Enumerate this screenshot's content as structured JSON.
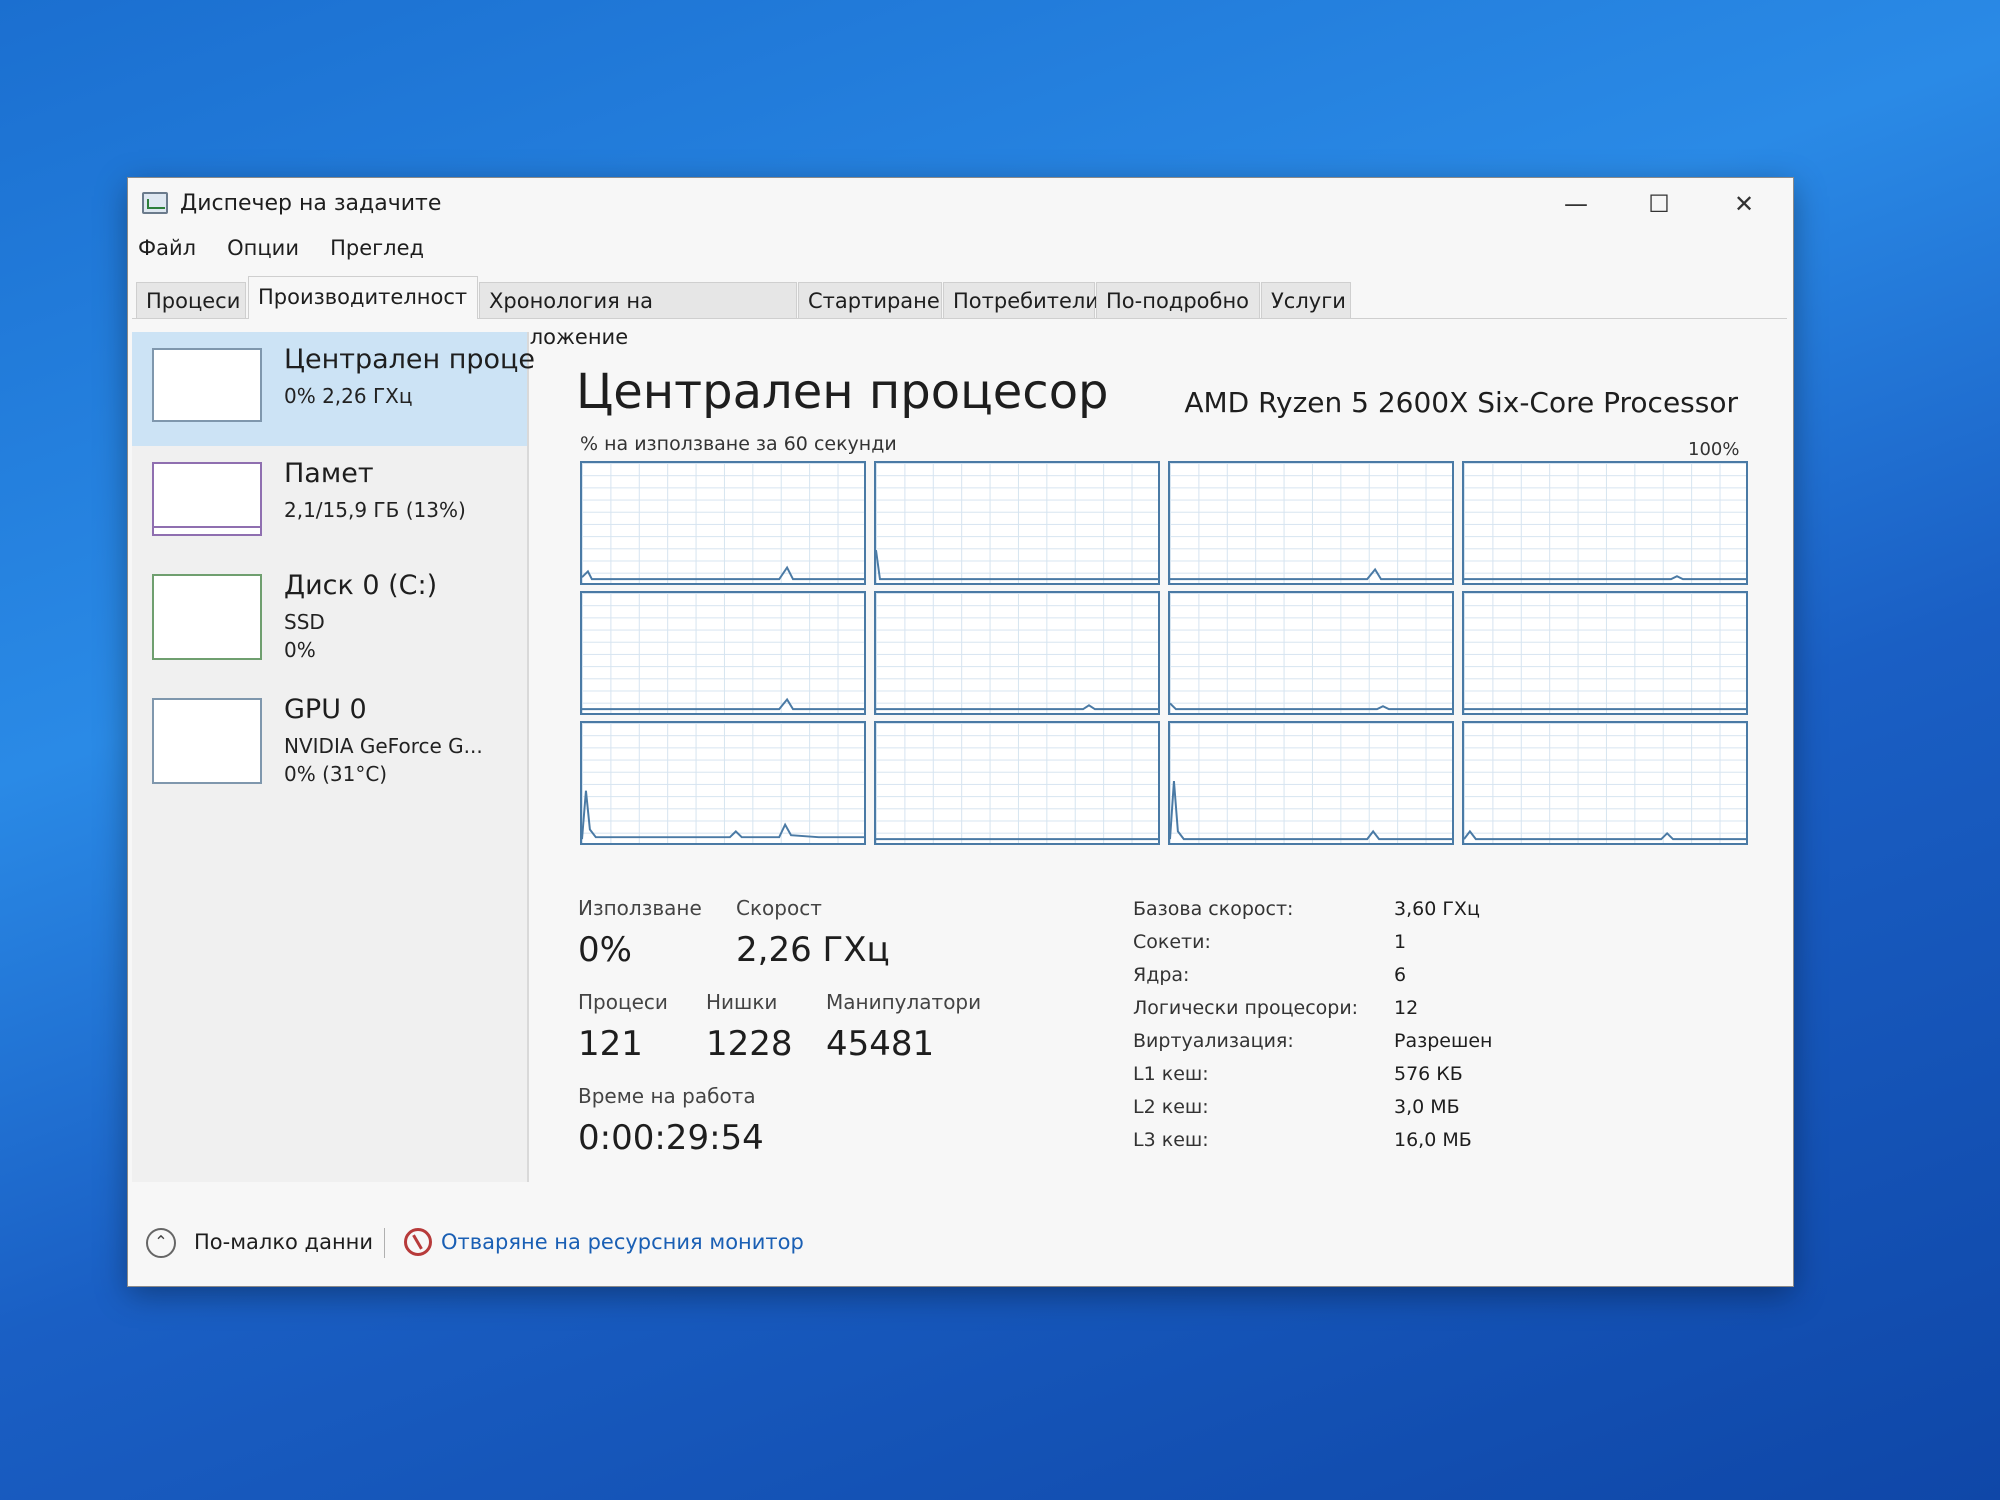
{
  "window": {
    "title": "Диспечер на задачите",
    "minimize_icon": "minimize-icon",
    "maximize_icon": "maximize-icon",
    "close_icon": "close-icon"
  },
  "menu": [
    "Файл",
    "Опции",
    "Преглед"
  ],
  "tabs": [
    {
      "label": "Процеси"
    },
    {
      "label": "Производителност",
      "active": true
    },
    {
      "label": "Хронология на приложение"
    },
    {
      "label": "Стартиране"
    },
    {
      "label": "Потребители"
    },
    {
      "label": "По-подробно"
    },
    {
      "label": "Услуги"
    }
  ],
  "sidebar": [
    {
      "name": "Централен проце",
      "lines": [
        "0% 2,26 ГХц"
      ]
    },
    {
      "name": "Памет",
      "lines": [
        "2,1/15,9 ГБ (13%)"
      ]
    },
    {
      "name": "Диск 0 (C:)",
      "lines": [
        "SSD",
        "0%"
      ]
    },
    {
      "name": "GPU 0",
      "lines": [
        "NVIDIA GeForce G...",
        "0% (31°C)"
      ]
    }
  ],
  "cpu": {
    "title": "Централен процесор",
    "model": "AMD Ryzen 5 2600X Six-Core Processor",
    "graph_label": "% на използване за 60 секунди",
    "graph_max": "100%",
    "usage_label": "Използване",
    "usage_value": "0%",
    "speed_label": "Скорост",
    "speed_value": "2,26 ГХц",
    "processes_label": "Процеси",
    "processes_value": "121",
    "threads_label": "Нишки",
    "threads_value": "1228",
    "handles_label": "Манипулатори",
    "handles_value": "45481",
    "uptime_label": "Време на работа",
    "uptime_value": "0:00:29:54",
    "details": [
      {
        "k": "Базова скорост:",
        "v": "3,60 ГХц"
      },
      {
        "k": "Сокети:",
        "v": "1"
      },
      {
        "k": "Ядра:",
        "v": "6"
      },
      {
        "k": "Логически процесори:",
        "v": "12"
      },
      {
        "k": "Виртуализация:",
        "v": "Разрешен"
      },
      {
        "k": "L1 кеш:",
        "v": "576 КБ"
      },
      {
        "k": "L2 кеш:",
        "v": "3,0 МБ"
      },
      {
        "k": "L3 кеш:",
        "v": "16,0 МБ"
      }
    ]
  },
  "footer": {
    "fewer_details": "По-малко данни",
    "resource_monitor": "Отваряне на ресурсния монитор"
  }
}
